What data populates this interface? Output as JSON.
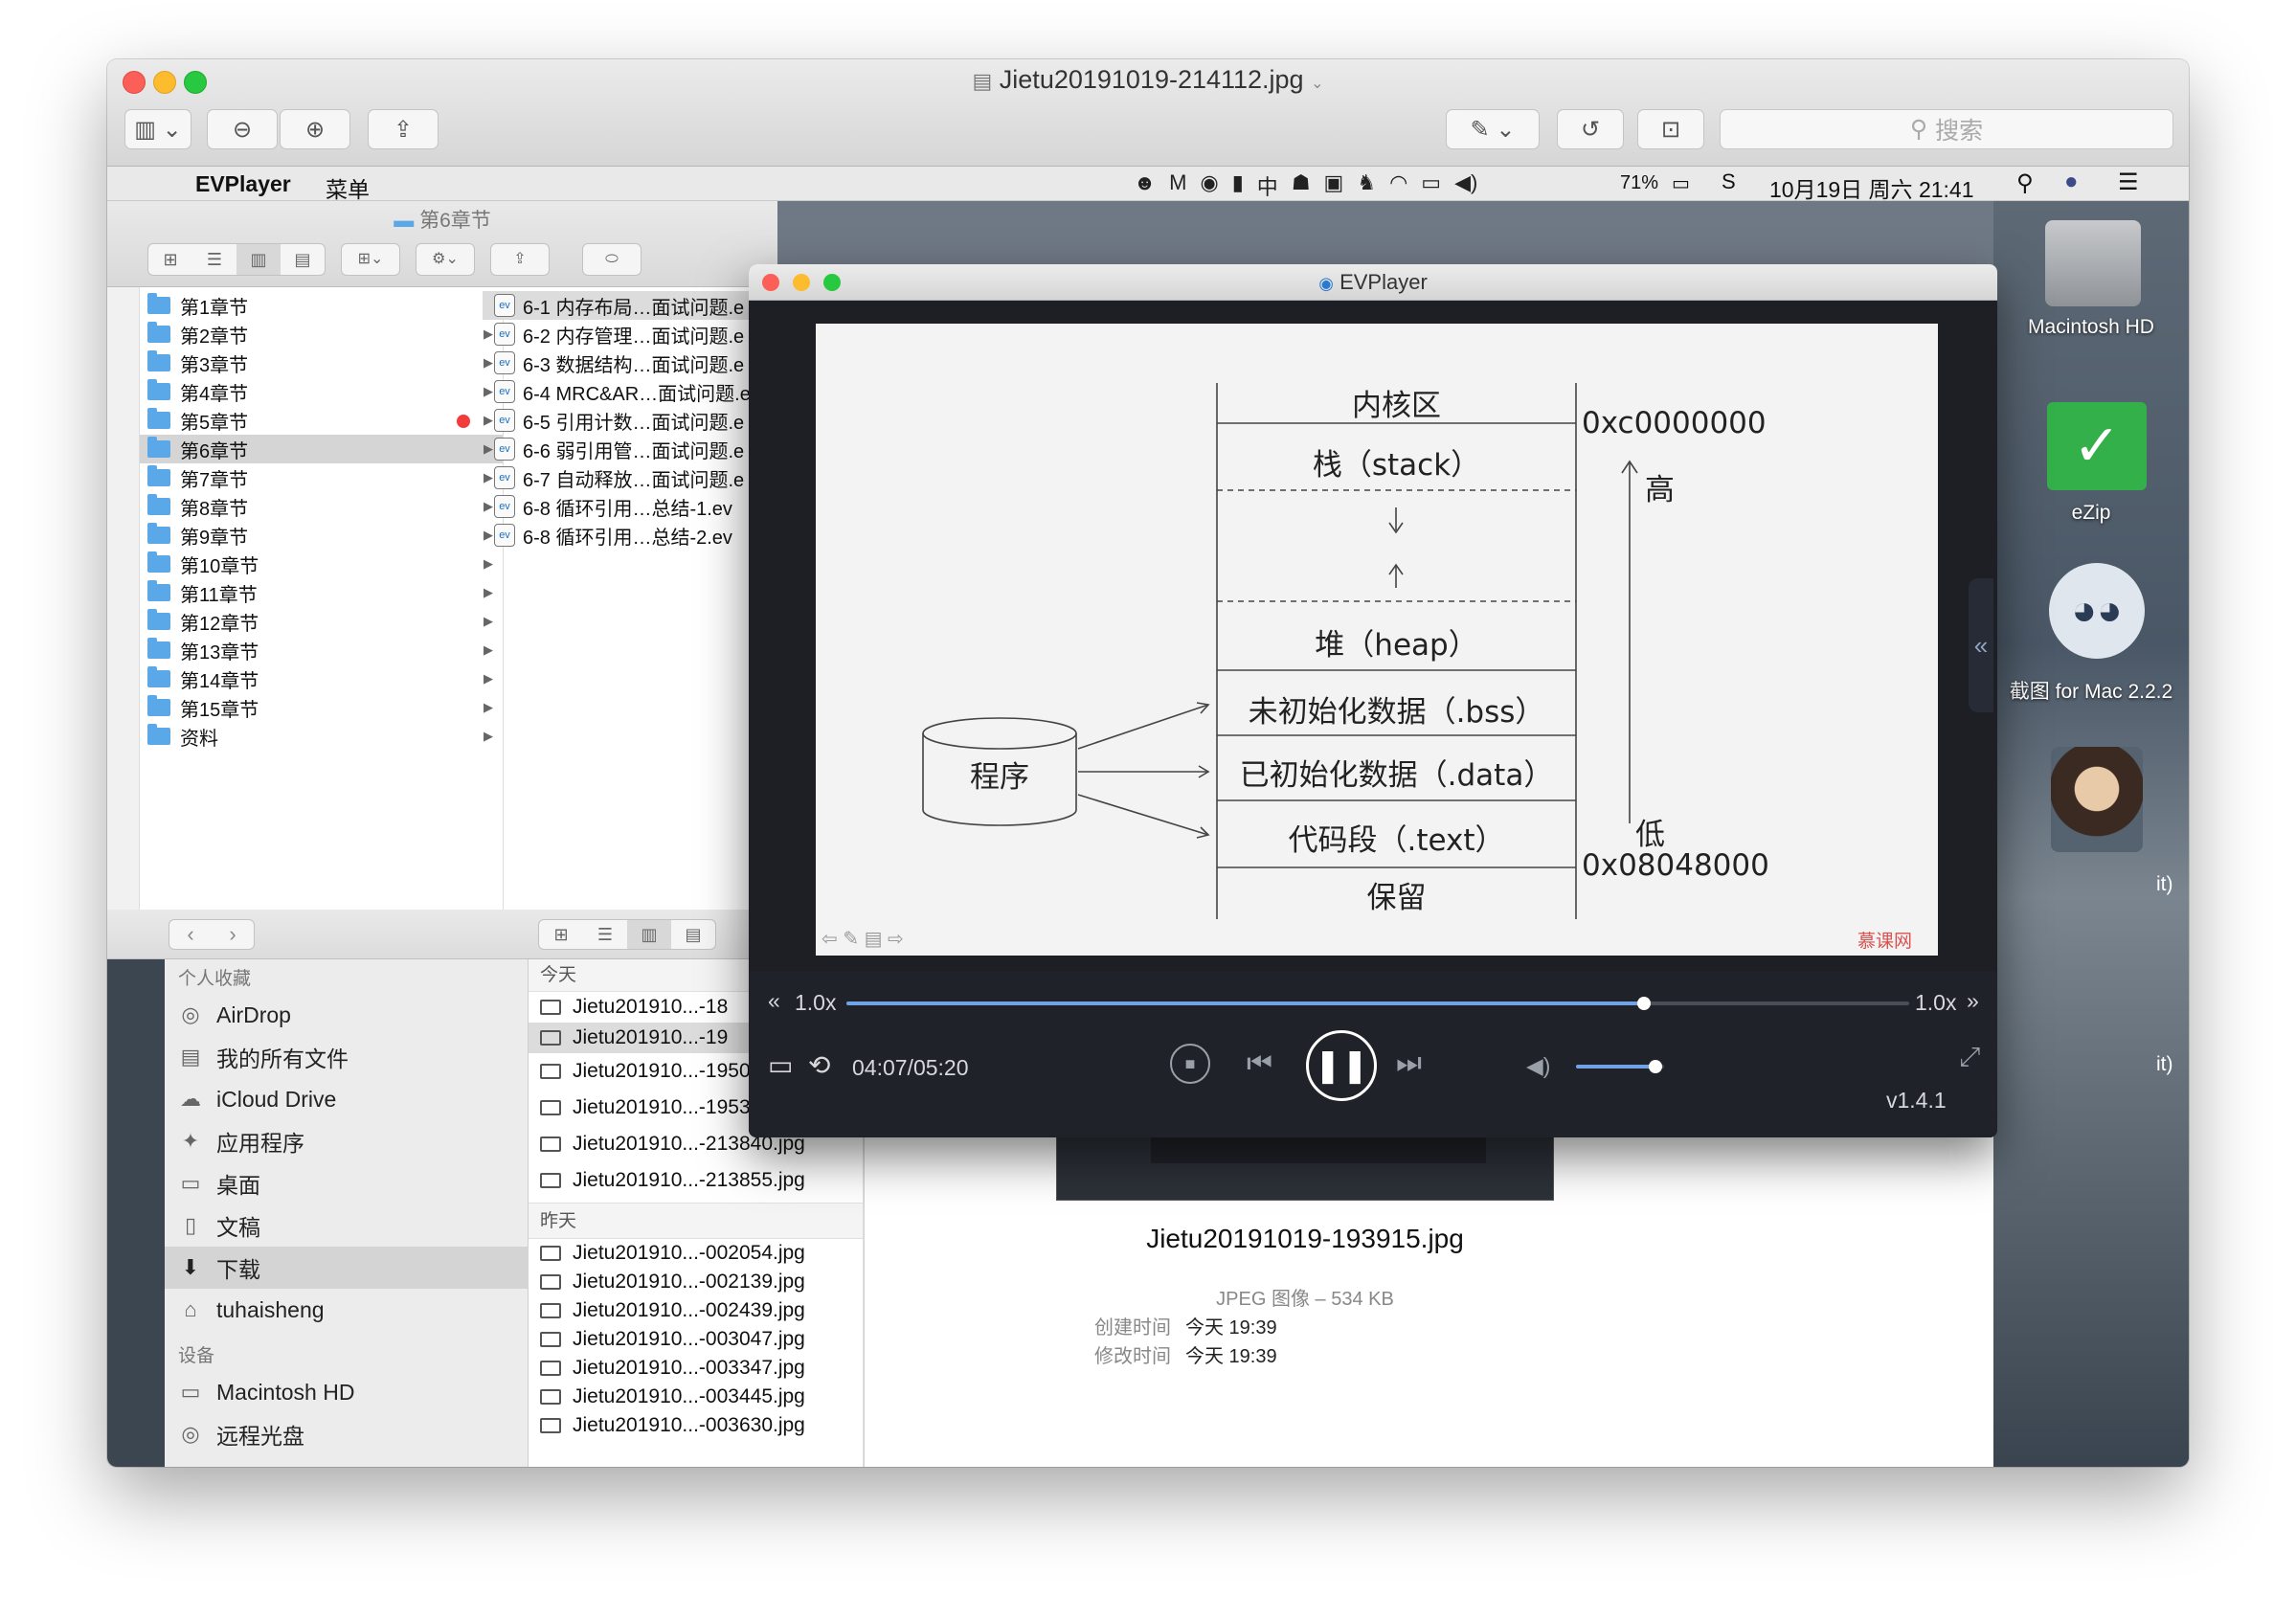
{
  "preview": {
    "title": "Jietu20191019-214112.jpg",
    "search_placeholder": "搜索"
  },
  "menubar": {
    "app": "EVPlayer",
    "menu": "菜单",
    "battery": "71%",
    "datetime": "10月19日 周六  21:41"
  },
  "finder_top": {
    "title": "第6章节",
    "chapters": [
      "第1章节",
      "第2章节",
      "第3章节",
      "第4章节",
      "第5章节",
      "第6章节",
      "第7章节",
      "第8章节",
      "第9章节",
      "第10章节",
      "第11章节",
      "第12章节",
      "第13章节",
      "第14章节",
      "第15章节",
      "资料"
    ],
    "selected_chapter_index": 5,
    "files": [
      "6-1 内存布局…面试问题.e",
      "6-2 内存管理…面试问题.e",
      "6-3 数据结构…面试问题.e",
      "6-4 MRC&AR…面试问题.e",
      "6-5 引用计数…面试问题.e",
      "6-6 弱引用管…面试问题.e",
      "6-7 自动释放…面试问题.e",
      "6-8 循环引用…总结-1.ev",
      "6-8 循环引用…总结-2.ev"
    ]
  },
  "finder_bottom": {
    "fav_header": "个人收藏",
    "favorites": [
      {
        "label": "AirDrop",
        "icon": "airdrop-icon",
        "glyph": "◎"
      },
      {
        "label": "我的所有文件",
        "icon": "all-files-icon",
        "glyph": "▤"
      },
      {
        "label": "iCloud Drive",
        "icon": "cloud-icon",
        "glyph": "☁"
      },
      {
        "label": "应用程序",
        "icon": "applications-icon",
        "glyph": "✦"
      },
      {
        "label": "桌面",
        "icon": "desktop-icon",
        "glyph": "▭"
      },
      {
        "label": "文稿",
        "icon": "documents-icon",
        "glyph": "▯"
      },
      {
        "label": "下载",
        "icon": "downloads-icon",
        "glyph": "⬇"
      },
      {
        "label": "tuhaisheng",
        "icon": "home-icon",
        "glyph": "⌂"
      }
    ],
    "devices_header": "设备",
    "devices": [
      {
        "label": "Macintosh HD",
        "icon": "disk-icon",
        "glyph": "▭"
      },
      {
        "label": "远程光盘",
        "icon": "optical-disc-icon",
        "glyph": "◎"
      }
    ],
    "today_header": "今天",
    "today_files": [
      "Jietu201910...-18",
      "Jietu201910...-19",
      "Jietu201910...-195013.jpg",
      "Jietu201910...-195343.jpg",
      "Jietu201910...-213840.jpg",
      "Jietu201910...-213855.jpg"
    ],
    "yesterday_header": "昨天",
    "yesterday_files": [
      "Jietu201910...-002054.jpg",
      "Jietu201910...-002139.jpg",
      "Jietu201910...-002439.jpg",
      "Jietu201910...-003047.jpg",
      "Jietu201910...-003347.jpg",
      "Jietu201910...-003445.jpg",
      "Jietu201910...-003630.jpg"
    ]
  },
  "info": {
    "filename": "Jietu20191019-193915.jpg",
    "kind": "JPEG 图像 – 534 KB",
    "created_label": "创建时间",
    "created_value": "今天 19:39",
    "modified_label": "修改时间",
    "modified_value": "今天 19:39"
  },
  "desktop": {
    "icons": [
      "Macintosh HD",
      "eZip",
      "截图 for Mac 2.2.2"
    ],
    "edge_text": [
      "it)",
      "it)"
    ]
  },
  "evplayer": {
    "title": "EVPlayer",
    "slide": {
      "segments": [
        "内核区",
        "栈（stack）",
        "堆（heap）",
        "未初始化数据（.bss）",
        "已初始化数据（.data）",
        "代码段（.text）",
        "保留"
      ],
      "program_label": "程序",
      "addr_high": "0xc0000000",
      "addr_low": "0x08048000",
      "high_label": "高",
      "low_label": "低",
      "watermark": "慕课网"
    },
    "speed_left": "1.0x",
    "speed_right": "1.0x",
    "speed_progress": 0.75,
    "time": "04:07/05:20",
    "playback_progress": 0.77,
    "volume_level": 0.9,
    "version": "v1.4.1"
  }
}
